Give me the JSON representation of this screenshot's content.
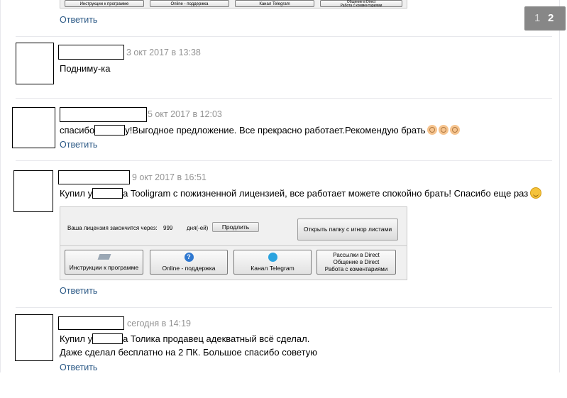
{
  "pagination": {
    "page_1": "1",
    "page_2": "2"
  },
  "top_strip": {
    "btn1": "Инструкции к программе",
    "btn2": "Online - поддержка",
    "btn3": "Канал Telegram",
    "btn4a": "Общение в Direct",
    "btn4b": "Работа с комментариями"
  },
  "reply_label": "Ответить",
  "comments": [
    {
      "date": "3 окт 2017 в 13:38",
      "text": "Подниму-ка"
    },
    {
      "date": "5 окт 2017 в 12:03",
      "text_a": "спасибо",
      "text_b": "у!Выгодное предложение. Все прекрасно работает.Рекомендую брать"
    },
    {
      "date": "9 окт 2017 в 16:51",
      "text_a": "Купил у",
      "text_b": "а Tooligram с пожизненной лицензией, все работает можете спокойно брать! Спасибо еще раз"
    },
    {
      "date": "сегодня в 14:19",
      "line1_a": "Купил у",
      "line1_b": "а Толика продавец адекватный всё сделал.",
      "line2": "Даже сделал бесплатно на 2 ПК. Большое спасибо советую"
    }
  ],
  "screenshot": {
    "license_label": "Ваша лицензия закончится через:",
    "license_days": "999",
    "days_unit": "дня(-ей)",
    "extend_button": "Продлить",
    "open_folder_button": "Открыть папку с игнор листами",
    "btn_instructions": "Инструкции к программе",
    "btn_support": "Online - поддержка",
    "btn_telegram": "Канал Telegram",
    "btn_direct_1": "Рассылки в Direct",
    "btn_direct_2": "Общение в Direct",
    "btn_direct_3": "Работа с коментариями"
  }
}
